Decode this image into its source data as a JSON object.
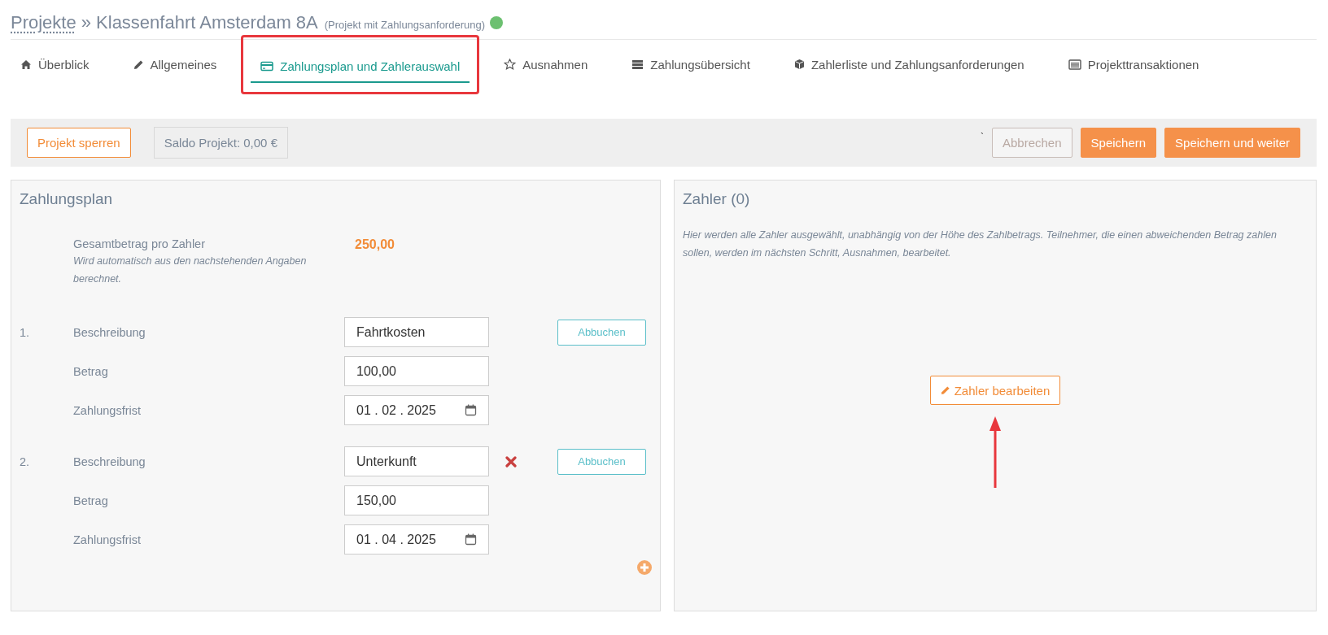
{
  "header": {
    "breadcrumb_link": "Projekte",
    "separator": "»",
    "title": "Klassenfahrt Amsterdam 8A",
    "subtitle": "(Projekt mit Zahlungsanforderung)"
  },
  "tabs": [
    {
      "label": "Überblick",
      "selected": false
    },
    {
      "label": "Allgemeines",
      "selected": false
    },
    {
      "label": "Zahlungsplan und Zahlerauswahl",
      "selected": true
    },
    {
      "label": "Ausnahmen",
      "selected": false
    },
    {
      "label": "Zahlungsübersicht",
      "selected": false
    },
    {
      "label": "Zahlerliste und Zahlungsanforderungen",
      "selected": false
    },
    {
      "label": "Projekttransaktionen",
      "selected": false
    }
  ],
  "toolbar": {
    "lock_button": "Projekt sperren",
    "balance": "Saldo Projekt: 0,00 €",
    "stray_mark": "`",
    "cancel_button": "Abbrechen",
    "save_button": "Speichern",
    "save_next_button": "Speichern und weiter"
  },
  "payment_plan": {
    "title": "Zahlungsplan",
    "total_label": "Gesamtbetrag pro Zahler",
    "total_hint": "Wird automatisch aus den nachstehenden Angaben berechnet.",
    "total_value": "250,00",
    "items": [
      {
        "number": "1.",
        "description_label": "Beschreibung",
        "description": "Fahrtkosten",
        "amount_label": "Betrag",
        "amount": "100,00",
        "deadline_label": "Zahlungsfrist",
        "deadline": "01 . 02 . 2025",
        "removable": false,
        "debit_button": "Abbuchen"
      },
      {
        "number": "2.",
        "description_label": "Beschreibung",
        "description": "Unterkunft",
        "amount_label": "Betrag",
        "amount": "150,00",
        "deadline_label": "Zahlungsfrist",
        "deadline": "01 . 04 . 2025",
        "removable": true,
        "debit_button": "Abbuchen"
      }
    ]
  },
  "payers": {
    "title": "Zahler (0)",
    "description": "Hier werden alle Zahler ausgewählt, unabhängig von der Höhe des Zahlbetrags. Teilnehmer, die einen abweichenden Betrag zahlen sollen, werden im nächsten Schritt, Ausnahmen, bearbeitet.",
    "edit_button": "Zahler bearbeiten"
  }
}
